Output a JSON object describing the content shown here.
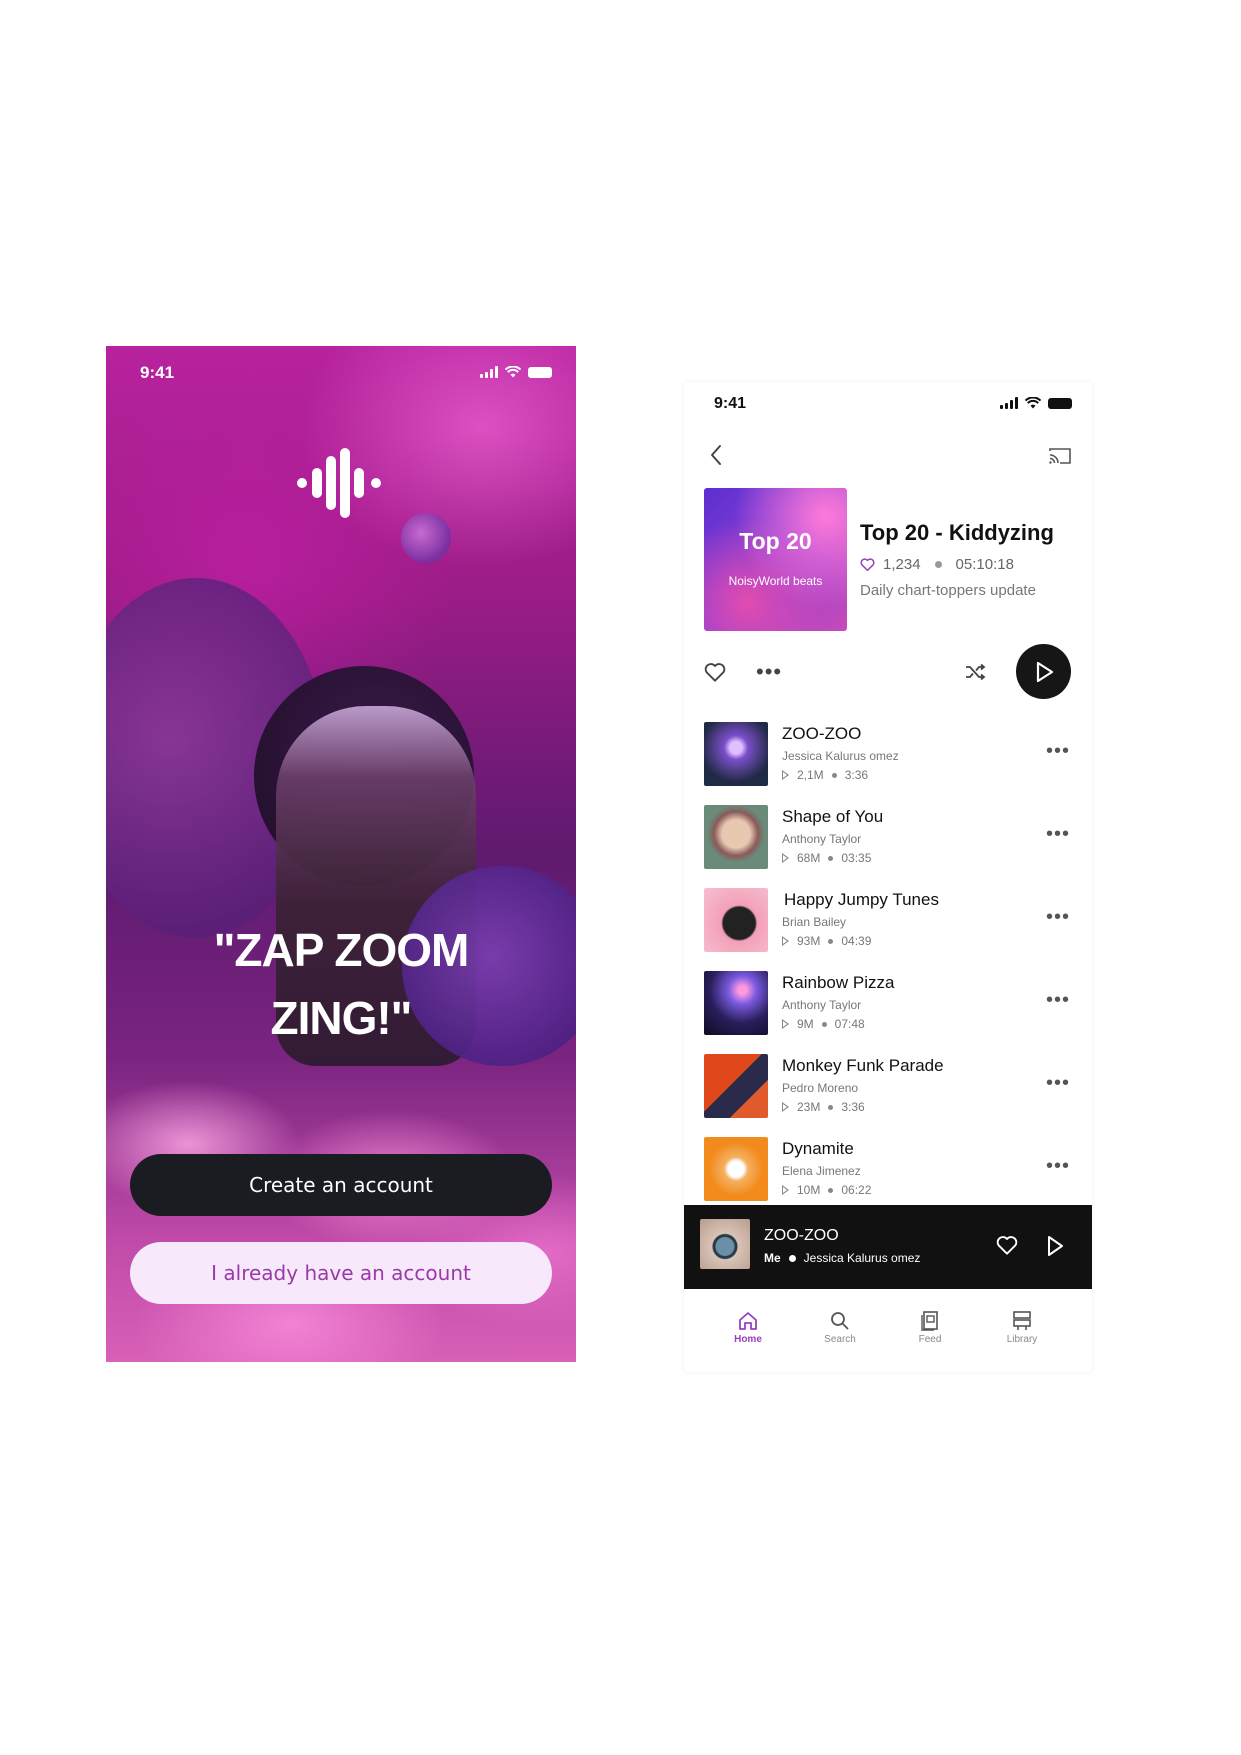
{
  "welcome": {
    "status_time": "9:41",
    "slogan_line1": "\"ZAP ZOOM",
    "slogan_line2": "ZING!\"",
    "create_account_label": "Create an account",
    "login_label": "I already have an account"
  },
  "player": {
    "status_time": "9:41",
    "cover": {
      "title": "Top 20",
      "subtitle": "NoisyWorld beats"
    },
    "playlist": {
      "title": "Top 20 - Kiddyzing",
      "likes": "1,234",
      "duration": "05:10:18",
      "description": "Daily chart-toppers update"
    },
    "tracks": [
      {
        "title": "ZOO-ZOO",
        "artist": "Jessica  Kalurus omez",
        "plays": "2,1M",
        "duration": "3:36",
        "thumb": "#1f2a44"
      },
      {
        "title": "Shape of You",
        "artist": "Anthony Taylor",
        "plays": "68M",
        "duration": "03:35",
        "thumb": "#b06a6a"
      },
      {
        "title": "Happy Jumpy Tunes",
        "artist": "Brian Bailey",
        "plays": "93M",
        "duration": "04:39",
        "thumb": "#f3a0b8"
      },
      {
        "title": "Rainbow Pizza",
        "artist": "Anthony Taylor",
        "plays": "9M",
        "duration": "07:48",
        "thumb": "#2a1f5c"
      },
      {
        "title": "Monkey Funk Parade",
        "artist": "Pedro Moreno",
        "plays": "23M",
        "duration": "3:36",
        "thumb": "#e0481c"
      },
      {
        "title": "Dynamite",
        "artist": "Elena Jimenez",
        "plays": "10M",
        "duration": "06:22",
        "thumb": "#f28a1c"
      }
    ],
    "now_playing": {
      "title": "ZOO-ZOO",
      "owner": "Me",
      "artist": "Jessica Kalurus omez"
    },
    "nav": [
      {
        "label": "Home",
        "icon": "home-icon"
      },
      {
        "label": "Search",
        "icon": "search-icon"
      },
      {
        "label": "Feed",
        "icon": "feed-icon"
      },
      {
        "label": "Library",
        "icon": "library-icon"
      }
    ]
  },
  "colors": {
    "accent": "#9b3fbf",
    "dark": "#161616",
    "login_bg": "#f7e9fb"
  }
}
